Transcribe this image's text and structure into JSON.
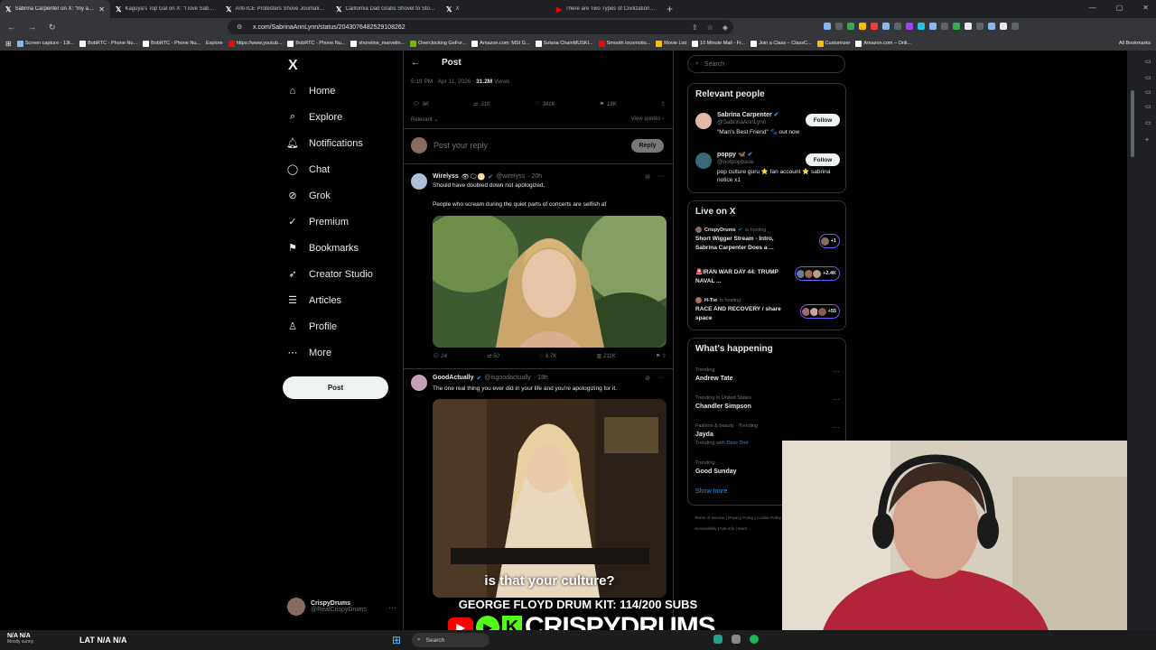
{
  "browser": {
    "tabs": [
      {
        "icon": "x-logo",
        "title": "Sabrina Carpenter on X: \"my ap...",
        "active": true
      },
      {
        "icon": "x-logo",
        "title": "Kaguya's Top Gal on X: \"I love Sabrin..."
      },
      {
        "icon": "x-logo",
        "title": "Anti-ICE Protesters Shove Journalist..."
      },
      {
        "icon": "x-logo",
        "title": "California Dad Grabs Shovel to Stop..."
      },
      {
        "icon": "x-logo",
        "title": "X"
      },
      {
        "icon": "youtube-logo",
        "title": "There are Two Types of Civilizations..."
      }
    ],
    "new_tab": "+",
    "url": "x.com/SabrinaAnnLynn/status/2043076482529108262",
    "bookmarks": [
      "Screen capture - 13t...",
      "BobRTC - Phone Nu...",
      "BobRTC - Phone Nu...",
      "Explore",
      "https://www.youtub...",
      "BobRTC - Phone Nu...",
      "shoreline_marvelin...",
      "Overclocking GeFor...",
      "Amazon.com: MSI G...",
      "Solana ChainMUSKI...",
      "Smooth locomotio...",
      "Movie List",
      "10 Minute Mail - Fr...",
      "Join a Class – ClassC...",
      "Customizer",
      "Amazon.com – Onli..."
    ],
    "all_bookmarks": "All Bookmarks",
    "accent": "#8ab4f8"
  },
  "sidebar": {
    "logo": "X",
    "items": [
      {
        "label": "Home",
        "icon": "home-icon"
      },
      {
        "label": "Explore",
        "icon": "search-icon"
      },
      {
        "label": "Notifications",
        "icon": "bell-icon"
      },
      {
        "label": "Chat",
        "icon": "chat-icon"
      },
      {
        "label": "Grok",
        "icon": "grok-icon"
      },
      {
        "label": "Premium",
        "icon": "premium-icon"
      },
      {
        "label": "Bookmarks",
        "icon": "bookmark-icon"
      },
      {
        "label": "Creator Studio",
        "icon": "rocket-icon"
      },
      {
        "label": "Articles",
        "icon": "article-icon"
      },
      {
        "label": "Profile",
        "icon": "person-icon"
      },
      {
        "label": "More",
        "icon": "more-icon"
      }
    ],
    "post_button": "Post",
    "account": {
      "name": "CrispyDrums",
      "handle": "@RealCrispyDrums"
    }
  },
  "main": {
    "header": "Post",
    "meta_time": "5:19 PM · Apr 11, 2026 ·",
    "meta_views": "31.2M",
    "meta_views_label": "Views",
    "stats": {
      "replies": "9K",
      "reposts": "31K",
      "likes": "341K",
      "bookmarks": "18K"
    },
    "relevant": "Relevant",
    "view_quotes": "View quotes",
    "reply_placeholder": "Post your reply",
    "reply_button": "Reply",
    "tweets": [
      {
        "name": "Wirelyss",
        "badges": "👁🗨🌕",
        "handle": "@wirelyss",
        "time": "· 20h",
        "text1": "Should have doubled down not apologized.",
        "text2": "People who scream during the quiet parts of concerts are selfish af",
        "actions": {
          "replies": "24",
          "reposts": "50",
          "likes": "6.7K",
          "views": "211K"
        }
      },
      {
        "name": "GoodActually",
        "handle": "@isgoodactually",
        "time": "· 18h",
        "text1": "The one real thing you ever did in your life and you're apologizing for it.",
        "caption": "is that your culture?"
      }
    ]
  },
  "right": {
    "search_placeholder": "Search",
    "relevant_people": {
      "title": "Relevant people",
      "people": [
        {
          "name": "Sabrina Carpenter",
          "handle": "@SabrinaAnnLynn",
          "bio": "\"Man's Best Friend\" 🐾 out now",
          "button": "Follow"
        },
        {
          "name": "poppy 🦋",
          "handle": "@notpopbase",
          "bio": "pop culture guru ⭐ fan account ⭐ sabrina notice x1",
          "button": "Follow"
        }
      ]
    },
    "live": {
      "title": "Live on X",
      "items": [
        {
          "host": "CrispyDrums",
          "hosting": "is hosting",
          "title": "Short Wigger Stream - Intro, Sabrina Carpenter Does a ...",
          "count": "+1"
        },
        {
          "host": "",
          "hosting": "",
          "title": "🚨IRAN WAR DAY 44: TRUMP NAVAL ...",
          "count": "+2.4K"
        },
        {
          "host": "H-Tio",
          "hosting": "is hosting",
          "title": "RACE AND RECOVERY / share space",
          "count": "+55"
        }
      ]
    },
    "happening": {
      "title": "What's happening",
      "trends": [
        {
          "context": "Trending",
          "name": "Andrew Tate"
        },
        {
          "context": "Trending in United States",
          "name": "Chandler Simpson"
        },
        {
          "context": "Fashion & beauty · Trending",
          "name": "Jayda",
          "with_label": "Trending with",
          "with": "Dess Dior"
        },
        {
          "context": "Trending",
          "name": "Good Sunday"
        }
      ],
      "show_more": "Show more"
    },
    "footer": [
      "Terms of Service",
      "Privacy Policy",
      "Cookie Policy",
      "Accessibility",
      "Ads info",
      "More ..."
    ]
  },
  "overlay": {
    "goal": "GEORGE FLOYD DRUM KIT: 114/200 SUBS",
    "brand": "CRISPYDRUMS"
  },
  "taskbar": {
    "weather": "N/A N/A",
    "weather_sub": "Mostly sunny",
    "lat": "LAT  N/A  N/A",
    "search": "Search"
  }
}
